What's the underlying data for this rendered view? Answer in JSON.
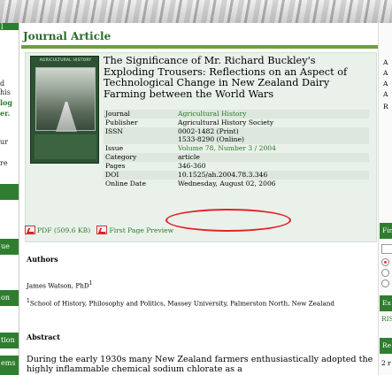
{
  "page": {
    "title": "Journal Article"
  },
  "left_sidebar": {
    "fragments_top": [
      "l",
      "d",
      "his",
      "log",
      "er.",
      "ur",
      "re"
    ],
    "green_items": [
      "",
      "ue",
      "on",
      "tion",
      "ems"
    ]
  },
  "article": {
    "title": "The Significance of Mr. Richard Buckley's Exploding Trousers: Reflections on an Aspect of Technological Change in New Zealand Dairy Farming between the World Wars",
    "cover_title": "AGRICULTURAL HISTORY",
    "meta": [
      {
        "key": "Journal",
        "value": "Agricultural History",
        "link": true
      },
      {
        "key": "Publisher",
        "value": "Agricultural History Society",
        "link": false
      },
      {
        "key": "ISSN",
        "value": "0002-1482 (Print)",
        "value2": "1533-8290 (Online)",
        "link": false
      },
      {
        "key": "Issue",
        "value": "Volume 78, Number 3 / 2004",
        "link": true
      },
      {
        "key": "Category",
        "value": "article",
        "link": false
      },
      {
        "key": "Pages",
        "value": "346-360",
        "link": false
      },
      {
        "key": "DOI",
        "value": "10.1525/ah.2004.78.3.346",
        "link": false
      },
      {
        "key": "Online Date",
        "value": "Wednesday, August 02, 2006",
        "link": false
      }
    ]
  },
  "links": {
    "pdf": "PDF (509.6 KB)",
    "preview": "First Page Preview"
  },
  "authors": {
    "heading": "Authors",
    "name": "James Watson, PhD",
    "sup": "1",
    "affiliation_sup": "1",
    "affiliation": "School of History, Philosophy and Politics, Massey University, Palmerston North, New Zealand"
  },
  "abstract": {
    "heading": "Abstract",
    "text": "During the early 1930s many New Zealand farmers enthusiastically adopted the highly inflammable chemical sodium chlorate as a"
  },
  "right_sidebar": {
    "top_letters": [
      "A",
      "A",
      "A",
      "A",
      "R"
    ],
    "labels": [
      "Fin",
      "Ex",
      "RIS",
      "Re",
      "2 r"
    ]
  },
  "colors": {
    "brand_green": "#2f7d2f",
    "title_green": "#2a6b2a",
    "link_green": "#2a7a2a",
    "panel_bg": "#eaf1ea",
    "annotation_red": "#e5222a"
  }
}
